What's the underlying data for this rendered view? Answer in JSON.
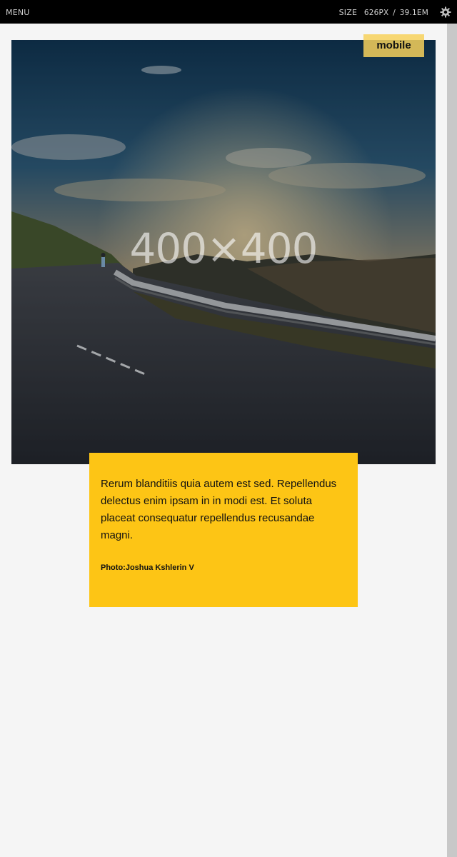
{
  "toolbar": {
    "menu_label": "MENU",
    "size_label": "SIZE",
    "size_px": "626PX",
    "size_separator": "/",
    "size_em": "39.1EM",
    "settings_icon": "gear-icon"
  },
  "hero": {
    "placeholder_label": "400×400",
    "badge_label": "mobile"
  },
  "caption": {
    "text": "Rerum blanditiis quia autem est sed. Repellendus delectus enim ipsam in in modi est. Et soluta placeat consequatur repellendus recusandae magni.",
    "credit": "Photo:Joshua Kshlerin V"
  },
  "colors": {
    "topbar_bg": "#000000",
    "caption_bg": "#fdc515",
    "badge_bg": "#f7d15c",
    "page_bg": "#f5f5f5"
  }
}
